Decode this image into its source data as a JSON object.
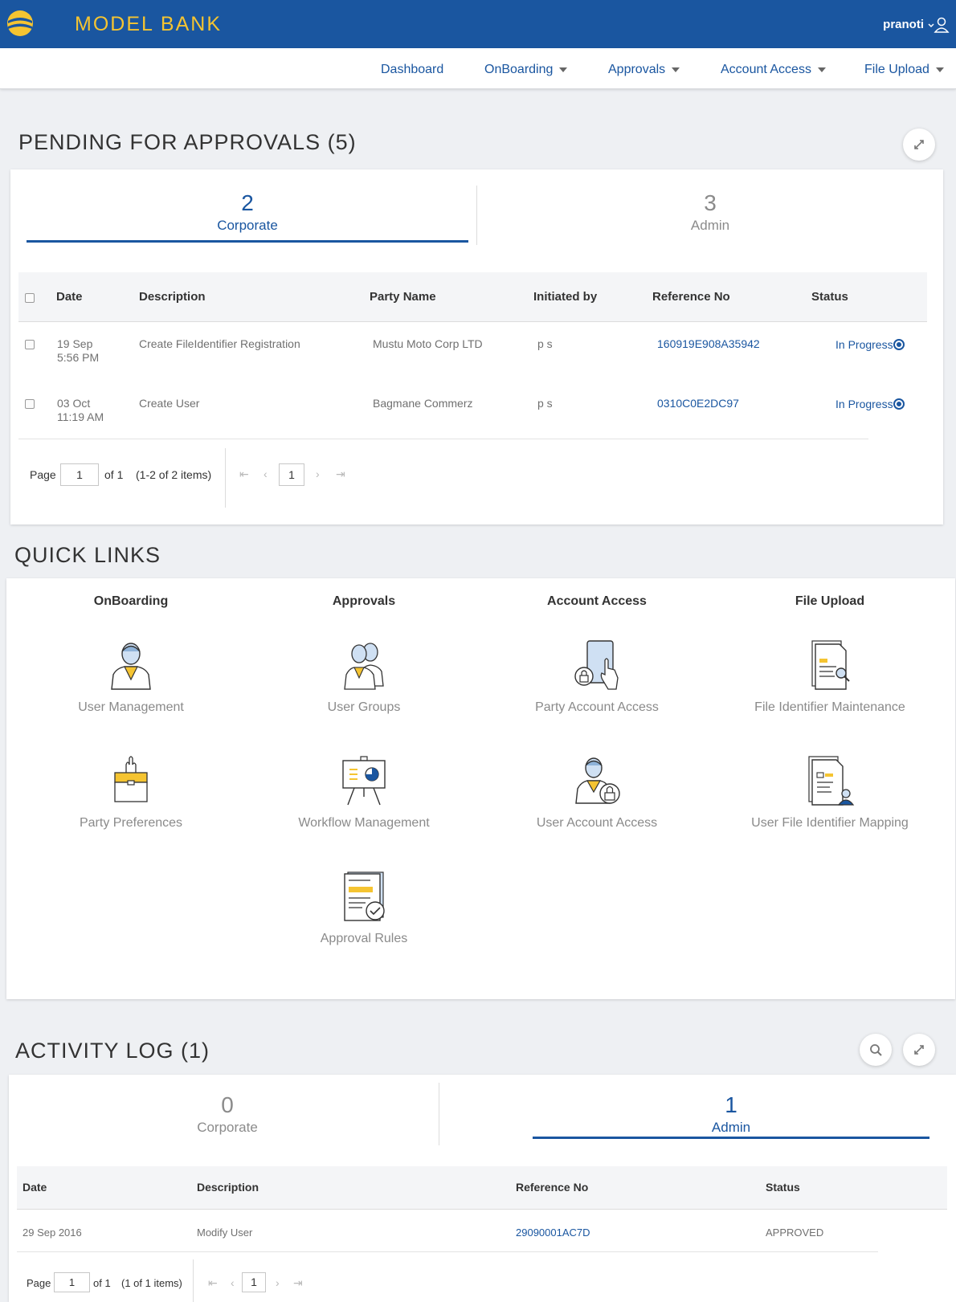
{
  "header": {
    "brand": "MODEL BANK",
    "username": "pranoti"
  },
  "nav": {
    "items": [
      {
        "label": "Dashboard"
      },
      {
        "label": "OnBoarding"
      },
      {
        "label": "Approvals"
      },
      {
        "label": "Account Access"
      },
      {
        "label": "File Upload"
      }
    ]
  },
  "pending": {
    "title": "PENDING FOR APPROVALS (5)",
    "tabs": [
      {
        "count": "2",
        "label": "Corporate"
      },
      {
        "count": "3",
        "label": "Admin"
      }
    ],
    "columns": [
      "Date",
      "Description",
      "Party Name",
      "Initiated by",
      "Reference No",
      "Status"
    ],
    "rows": [
      {
        "date": "19 Sep",
        "time": "5:56 PM",
        "description": "Create FileIdentifier Registration",
        "party": "Mustu Moto Corp LTD",
        "initiated_by": "p s",
        "reference": "160919E908A35942",
        "status": "In Progress"
      },
      {
        "date": "03 Oct",
        "time": "11:19 AM",
        "description": "Create User",
        "party": "Bagmane Commerz",
        "initiated_by": "p s",
        "reference": "0310C0E2DC97",
        "status": "In Progress"
      }
    ],
    "pager": {
      "page_label": "Page",
      "page_value": "1",
      "of_text": "of 1",
      "items_text": "(1-2 of 2 items)",
      "current": "1"
    }
  },
  "quick_links": {
    "title": "QUICK LINKS",
    "columns": [
      "OnBoarding",
      "Approvals",
      "Account Access",
      "File Upload"
    ],
    "items": [
      {
        "label": "User Management",
        "icon": "user-icon"
      },
      {
        "label": "User Groups",
        "icon": "users-icon"
      },
      {
        "label": "Party Account Access",
        "icon": "tablet-lock-icon"
      },
      {
        "label": "File Identifier Maintenance",
        "icon": "document-search-icon"
      },
      {
        "label": "Party Preferences",
        "icon": "briefcase-icon"
      },
      {
        "label": "Workflow Management",
        "icon": "presentation-board-icon"
      },
      {
        "label": "User Account Access",
        "icon": "user-lock-icon"
      },
      {
        "label": "User File Identifier Mapping",
        "icon": "document-user-icon"
      },
      {
        "label": "Approval Rules",
        "icon": "document-check-icon"
      }
    ]
  },
  "activity": {
    "title": "ACTIVITY LOG (1)",
    "tabs": [
      {
        "count": "0",
        "label": "Corporate"
      },
      {
        "count": "1",
        "label": "Admin"
      }
    ],
    "columns": [
      "Date",
      "Description",
      "Reference No",
      "Status"
    ],
    "rows": [
      {
        "date": "29 Sep 2016",
        "description": "Modify User",
        "reference": "29090001AC7D",
        "status": "APPROVED"
      }
    ],
    "pager": {
      "page_label": "Page",
      "page_value": "1",
      "of_text": "of 1",
      "items_text": "(1 of 1 items)",
      "current": "1"
    }
  },
  "colors": {
    "primary": "#1a56a0",
    "accent": "#f5c431",
    "background": "#eef0f3"
  }
}
